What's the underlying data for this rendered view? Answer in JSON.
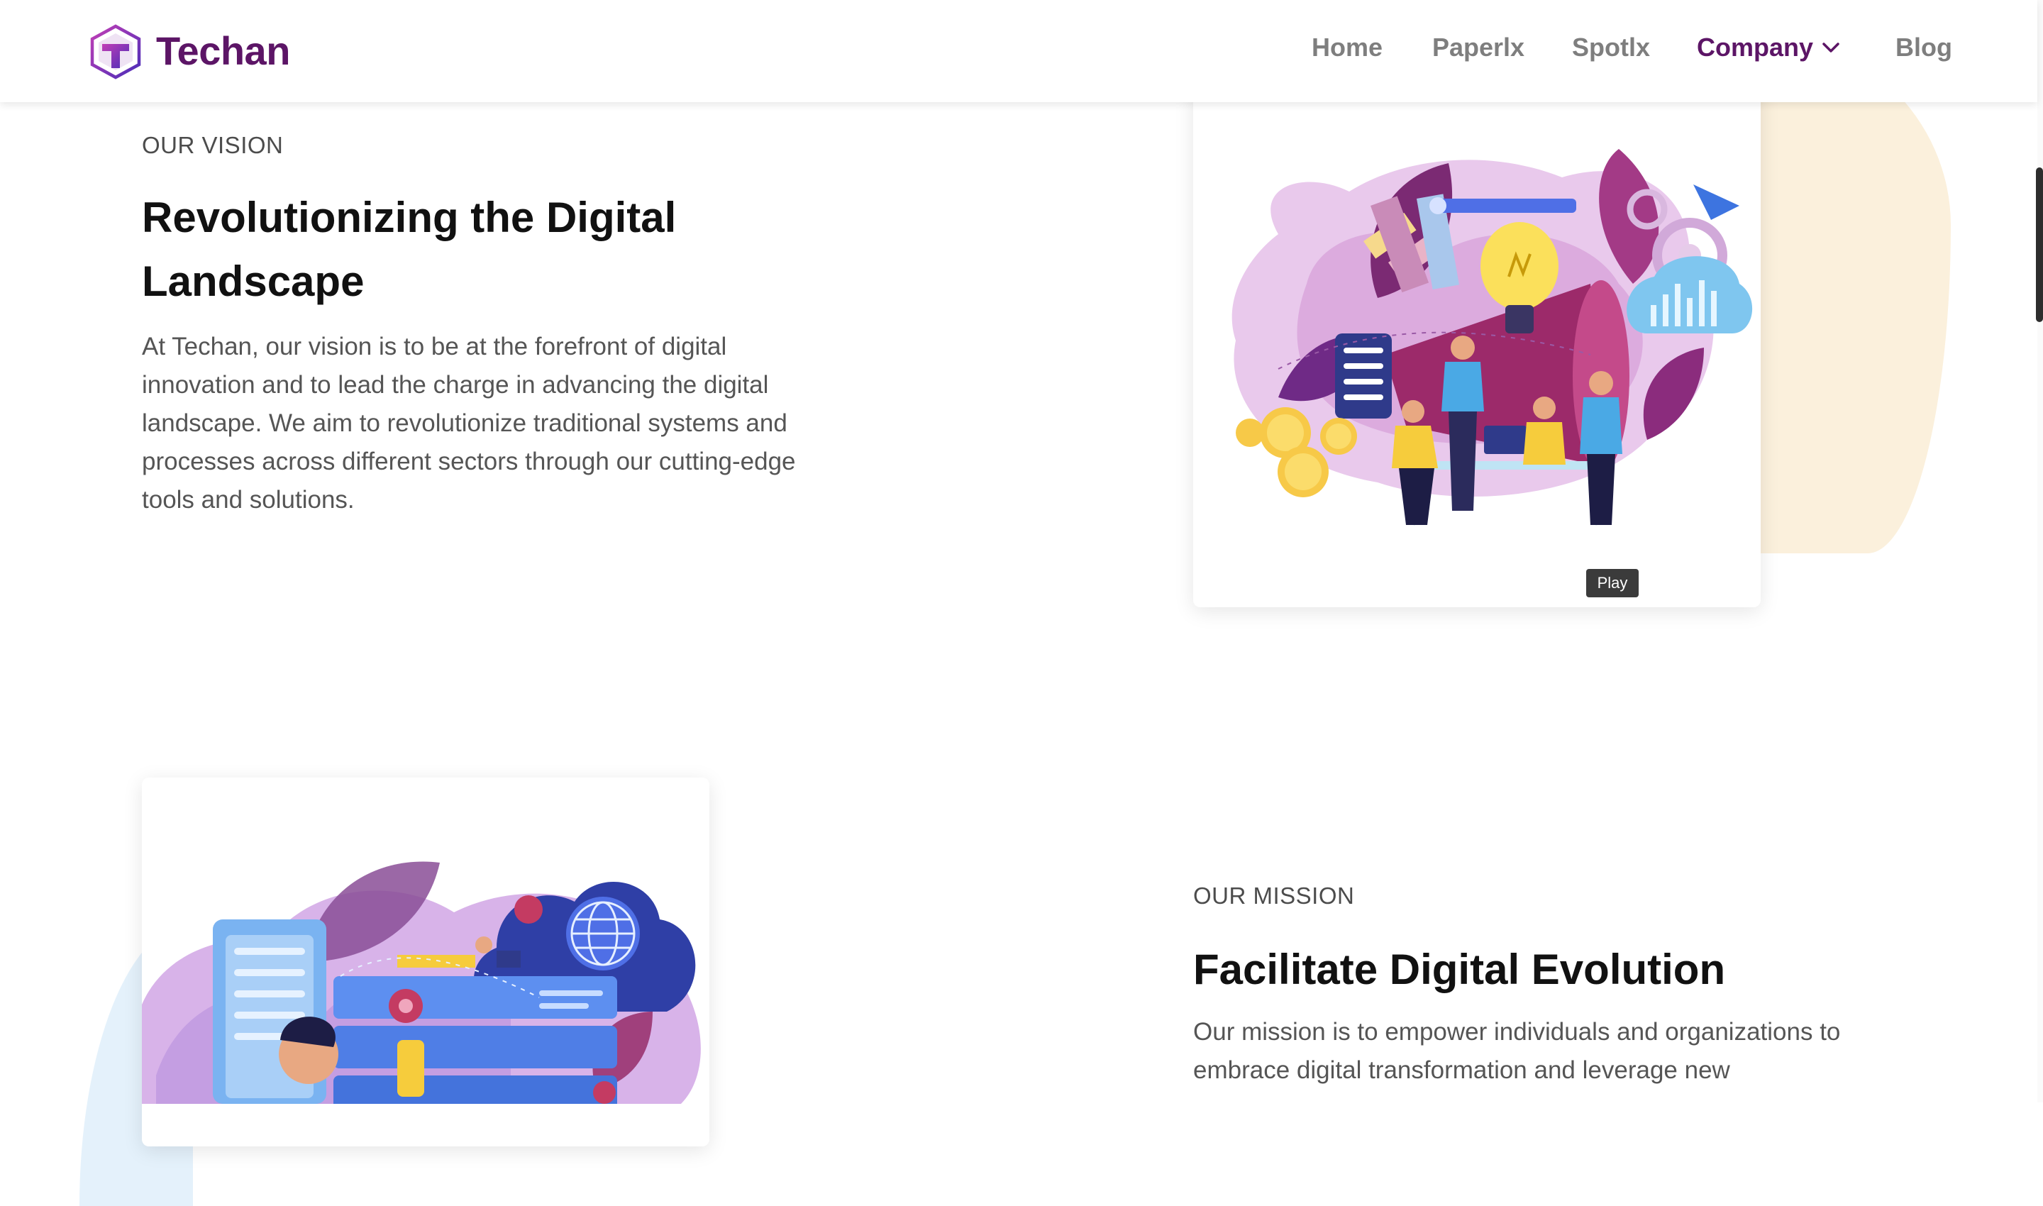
{
  "header": {
    "brand": "Techan",
    "nav": {
      "home": "Home",
      "paperlx": "Paperlx",
      "spotlx": "Spotlx",
      "company": "Company",
      "blog": "Blog"
    },
    "active_nav": "Company"
  },
  "vision": {
    "eyebrow": "OUR VISION",
    "heading": "Revolutionizing the Digital Landscape",
    "paragraph": "At Techan, our vision is to be at the forefront of digital innovation and to lead the charge in advancing the digital landscape. We aim to revolutionize traditional systems and processes across different sectors through our cutting-edge tools and solutions.",
    "tooltip": "Play"
  },
  "mission": {
    "eyebrow": "OUR MISSION",
    "heading": "Facilitate Digital Evolution",
    "paragraph": "Our mission is to empower individuals and organizations to embrace digital transformation and leverage new"
  },
  "colors": {
    "brand": "#5c1566",
    "nav_inactive": "#7e7e7e",
    "peach_blob": "#fbf0dc",
    "blue_blob": "#e4f1fb"
  },
  "icons": [
    "techan-logo-icon",
    "chevron-down-icon"
  ]
}
